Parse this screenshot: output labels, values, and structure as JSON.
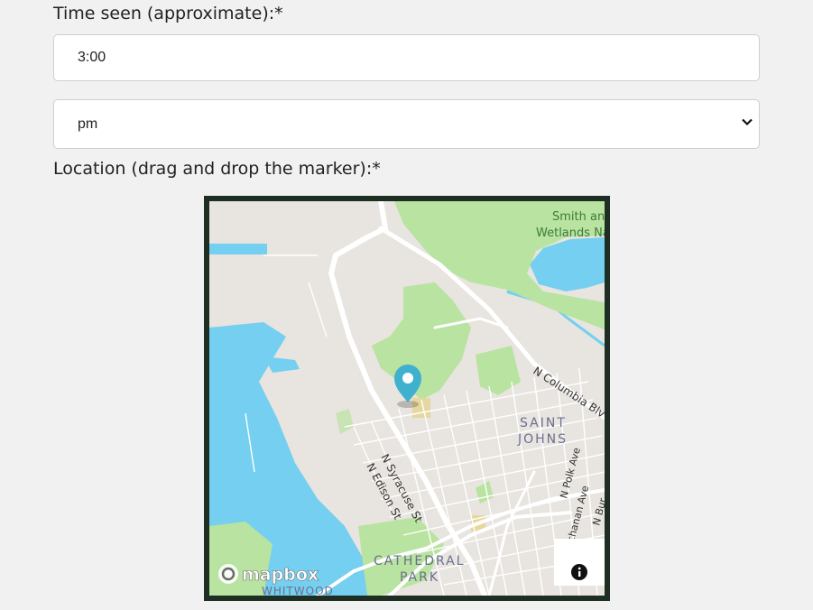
{
  "form": {
    "time_label": "Time seen (approximate):*",
    "time_value": "3:00",
    "ampm_value": "pm",
    "location_label": "Location (drag and drop the marker):*"
  },
  "map": {
    "labels": {
      "wetlands_1": "Smith an",
      "wetlands_2": "Wetlands Na",
      "columbia": "N Columbia Blv",
      "saint": "SAINT",
      "johns": "JOHNS",
      "polk": "N Polk Ave",
      "buchanan": "uchanan Ave",
      "burr": "N Bur",
      "syracuse": "N Syracuse St",
      "edison": "N Edison St",
      "cathedral": "CATHEDRAL",
      "park": "PARK",
      "whitwood": "WHITWOOD",
      "mapbox": "mapbox"
    },
    "icons": [
      "location-pin-icon",
      "info-icon",
      "mapbox-logo-icon"
    ],
    "colors": {
      "land": "#e8e4df",
      "water": "#75cff0",
      "park": "#b9e3a0",
      "marker": "#3fb1ce"
    }
  }
}
